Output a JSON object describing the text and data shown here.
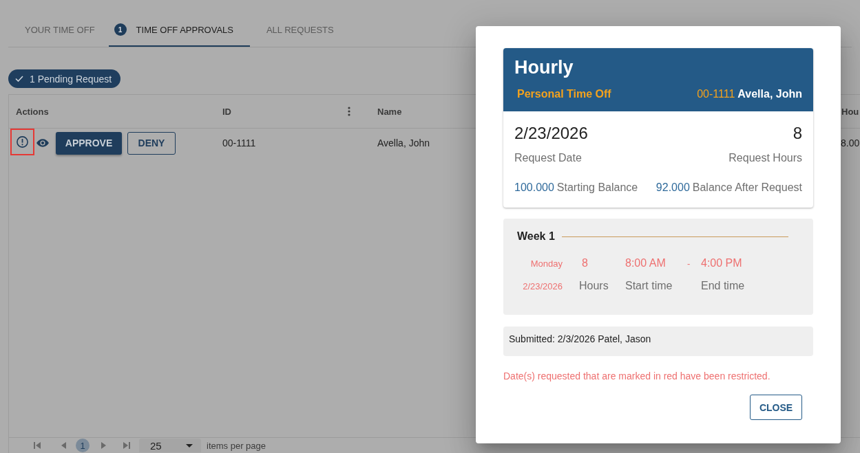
{
  "tabs": [
    {
      "label": "YOUR TIME OFF",
      "selected": false
    },
    {
      "label": "TIME OFF APPROVALS",
      "selected": true,
      "badge": "1"
    },
    {
      "label": "ALL REQUESTS",
      "selected": false
    }
  ],
  "pending_chip": {
    "label": "1 Pending Request"
  },
  "table": {
    "columns": [
      {
        "label": "Actions",
        "menu": false
      },
      {
        "label": "ID",
        "menu": true
      },
      {
        "label": "Name",
        "menu": false
      },
      {
        "label": "Hou",
        "menu": false
      }
    ],
    "rows": [
      {
        "alert_highlighted": true,
        "approve": "APPROVE",
        "deny": "DENY",
        "cells": [
          "",
          "00-1111",
          "Avella, John",
          "8.00"
        ]
      }
    ]
  },
  "pagination": {
    "pages": [
      {
        "label": "1",
        "selected": true
      }
    ],
    "page_size": "25",
    "page_size_label": "items per page"
  },
  "dialog": {
    "card": {
      "title": "Hourly",
      "type": "Personal Time Off",
      "employee_id": "00-1111",
      "employee_name": "Avella, John",
      "date": "2/23/2026",
      "date_label": "Request Date",
      "hours": "8",
      "hours_label": "Request Hours",
      "starting_balance": "100.000",
      "starting_balance_label": "Starting Balance",
      "after_balance": "92.000",
      "after_balance_label": "Balance After Request"
    },
    "weeks": [
      {
        "title": "Week 1",
        "days": [
          {
            "weekday": "Monday",
            "date": "2/23/2026",
            "hours": "8",
            "hours_label": "Hours",
            "start": "8:00 AM",
            "start_label": "Start time",
            "separator": "-",
            "end": "4:00 PM",
            "end_label": "End time",
            "restricted": true
          }
        ]
      }
    ],
    "submitted": "Submitted: 2/3/2026 Patel, Jason",
    "note": "Date(s) requested that are marked in red have been restricted.",
    "buttons": [
      {
        "label": "CLOSE"
      }
    ]
  }
}
